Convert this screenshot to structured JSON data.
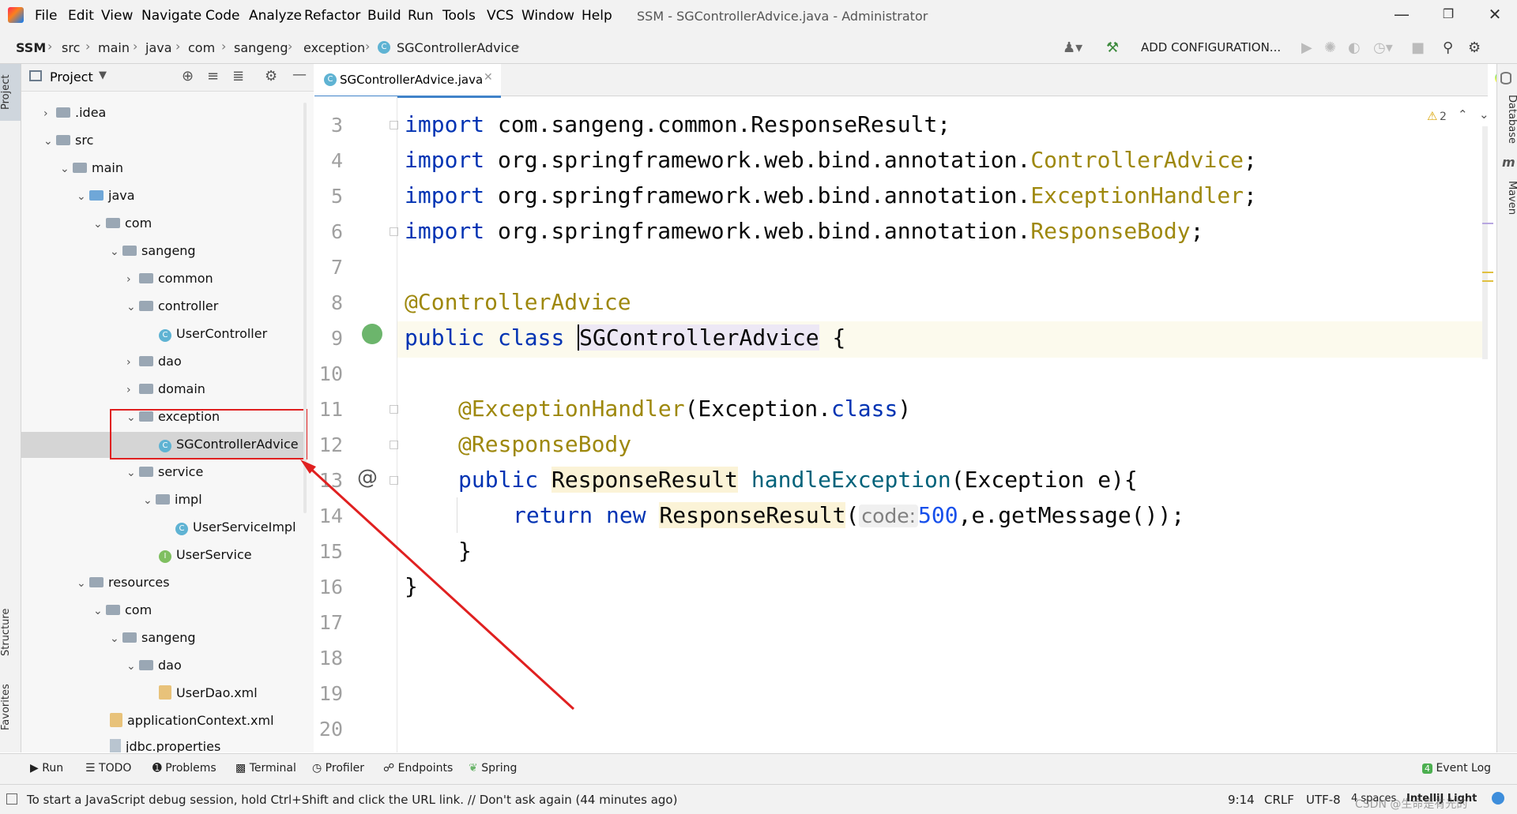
{
  "menu": {
    "items": [
      "File",
      "Edit",
      "View",
      "Navigate",
      "Code",
      "Analyze",
      "Refactor",
      "Build",
      "Run",
      "Tools",
      "VCS",
      "Window",
      "Help"
    ],
    "window_title": "SSM - SGControllerAdvice.java - Administrator"
  },
  "breadcrumb": [
    "SSM",
    "src",
    "main",
    "java",
    "com",
    "sangeng",
    "exception",
    "SGControllerAdvice"
  ],
  "toolbar": {
    "add_config_label": "ADD CONFIGURATION..."
  },
  "side_tabs": {
    "project": "Project",
    "structure": "Structure",
    "favorites": "Favorites",
    "database": "Database",
    "maven": "Maven"
  },
  "project_panel": {
    "title": "Project"
  },
  "tree": [
    {
      "label": ".idea",
      "type": "folder",
      "state": "collapsed"
    },
    {
      "label": "src",
      "type": "folder",
      "state": "expanded"
    },
    {
      "label": "main",
      "type": "folder",
      "state": "expanded"
    },
    {
      "label": "java",
      "type": "source-folder",
      "state": "expanded"
    },
    {
      "label": "com",
      "type": "folder",
      "state": "expanded"
    },
    {
      "label": "sangeng",
      "type": "folder",
      "state": "expanded"
    },
    {
      "label": "common",
      "type": "folder",
      "state": "collapsed"
    },
    {
      "label": "controller",
      "type": "folder",
      "state": "expanded"
    },
    {
      "label": "UserController",
      "type": "class"
    },
    {
      "label": "dao",
      "type": "folder",
      "state": "collapsed"
    },
    {
      "label": "domain",
      "type": "folder",
      "state": "collapsed"
    },
    {
      "label": "exception",
      "type": "folder",
      "state": "expanded"
    },
    {
      "label": "SGControllerAdvice",
      "type": "class",
      "selected": true
    },
    {
      "label": "service",
      "type": "folder",
      "state": "expanded"
    },
    {
      "label": "impl",
      "type": "folder",
      "state": "expanded"
    },
    {
      "label": "UserServiceImpl",
      "type": "class"
    },
    {
      "label": "UserService",
      "type": "interface"
    },
    {
      "label": "resources",
      "type": "folder",
      "state": "expanded"
    },
    {
      "label": "com",
      "type": "folder",
      "state": "expanded"
    },
    {
      "label": "sangeng",
      "type": "folder",
      "state": "expanded"
    },
    {
      "label": "dao",
      "type": "folder",
      "state": "expanded"
    },
    {
      "label": "UserDao.xml",
      "type": "xml"
    },
    {
      "label": "applicationContext.xml",
      "type": "xml"
    },
    {
      "label": "jdbc.properties",
      "type": "properties"
    }
  ],
  "editor": {
    "tab_label": "SGControllerAdvice.java",
    "warning_count": "2",
    "line_numbers": [
      "3",
      "4",
      "5",
      "6",
      "7",
      "8",
      "9",
      "10",
      "11",
      "12",
      "13",
      "14",
      "15",
      "16",
      "17",
      "18",
      "19",
      "20"
    ],
    "lines": {
      "l3": {
        "kw": "import",
        "pkg": " com.sangeng.common.ResponseResult;"
      },
      "l4": {
        "kw": "import",
        "pkg": " org.springframework.web.bind.annotation.",
        "cls": "ControllerAdvice",
        "end": ";"
      },
      "l5": {
        "kw": "import",
        "pkg": " org.springframework.web.bind.annotation.",
        "cls": "ExceptionHandler",
        "end": ";"
      },
      "l6": {
        "kw": "import",
        "pkg": " org.springframework.web.bind.annotation.",
        "cls": "ResponseBody",
        "end": ";"
      },
      "l8": {
        "ann": "@ControllerAdvice"
      },
      "l9": {
        "kw1": "public",
        "kw2": "class",
        "name": "SGControllerAdvice",
        "end": " {"
      },
      "l11": {
        "ann": "@ExceptionHandler",
        "rest1": "(Exception.",
        "kw": "class",
        "rest2": ")"
      },
      "l12": {
        "ann": "@ResponseBody"
      },
      "l13": {
        "kw": "public",
        "type": "ResponseResult",
        "method": "handleException",
        "rest": "(Exception e){"
      },
      "l14": {
        "kw1": "return",
        "kw2": "new",
        "type": "ResponseResult",
        "open": "(",
        "hint": "code:",
        "num": "500",
        "rest": ",e.getMessage());"
      },
      "l15": {
        "text": "}"
      },
      "l16": {
        "text": "}"
      }
    }
  },
  "bottom_tools": [
    "Run",
    "TODO",
    "Problems",
    "Terminal",
    "Profiler",
    "Endpoints",
    "Spring"
  ],
  "event_log": "Event Log",
  "status": {
    "message": "To start a JavaScript debug session, hold Ctrl+Shift and click the URL link. // Don't ask again (44 minutes ago)",
    "position": "9:14",
    "line_sep": "CRLF",
    "encoding": "UTF-8",
    "indent": "4 spaces",
    "theme": "IntelliJ Light",
    "watermark": "CSDN @生命是有光的"
  }
}
